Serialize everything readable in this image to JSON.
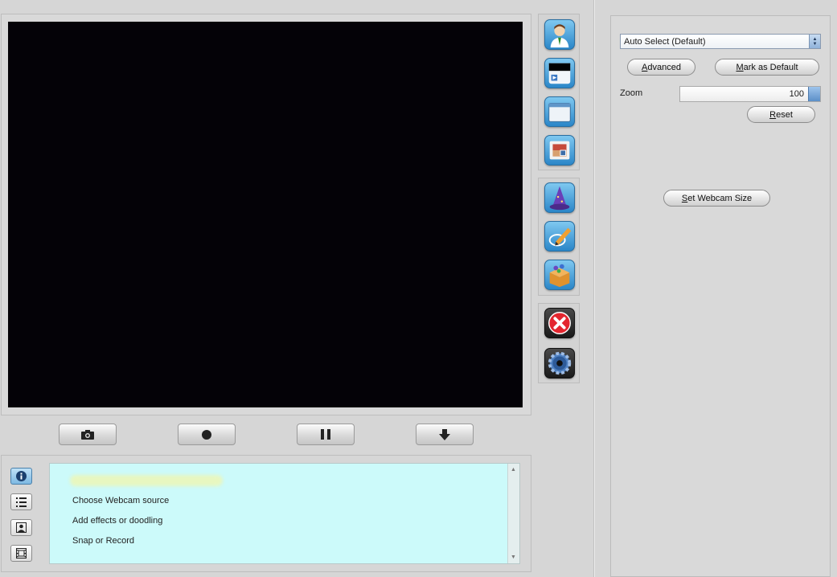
{
  "capture_buttons": {
    "snapshot_icon": "camera-icon",
    "record_icon": "record-icon",
    "pause_icon": "pause-icon",
    "save_icon": "download-arrow-icon"
  },
  "toolbar": {
    "group1": [
      "user-profile-icon",
      "video-player-icon",
      "window-icon",
      "picture-frame-icon"
    ],
    "group2": [
      "wizard-hat-icon",
      "pencil-doodle-icon",
      "effects-box-icon"
    ],
    "group3": [
      "close-icon",
      "settings-gear-icon"
    ]
  },
  "info": {
    "items": [
      "Choose Webcam source",
      "Add effects or doodling",
      "Snap or Record"
    ],
    "tabs": [
      "info-icon",
      "list-icon",
      "portrait-icon",
      "film-icon"
    ]
  },
  "settings": {
    "source_select_value": "Auto Select (Default)",
    "advanced_access_key": "A",
    "advanced_rest": "dvanced",
    "mark_default_access_key": "M",
    "mark_default_rest": "ark as Default",
    "zoom_label": "Zoom",
    "zoom_value": "100",
    "reset_access_key": "R",
    "reset_rest": "eset",
    "webcam_size_access_key": "S",
    "webcam_size_rest": "et Webcam Size"
  },
  "colors": {
    "video_background": "#040207",
    "info_background": "#ccfafa",
    "accent_blue": "#2a86c8"
  }
}
